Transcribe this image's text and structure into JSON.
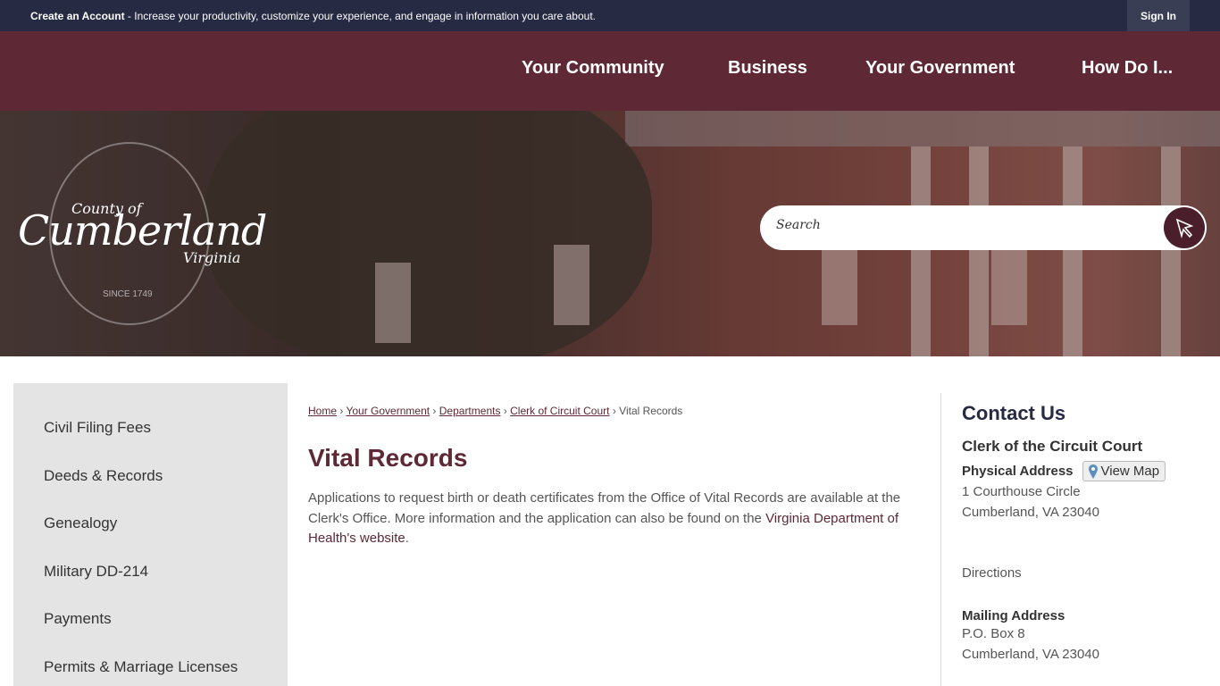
{
  "topbar": {
    "create_account": "Create an Account",
    "message": " - Increase your productivity, customize your experience, and engage in information you care about.",
    "sign_in": "Sign In"
  },
  "nav": [
    "Your Community",
    "Business",
    "Your Government",
    "How Do I..."
  ],
  "logo": {
    "county_of": "County of",
    "name": "Cumberland",
    "state": "Virginia",
    "since": "SINCE 1749"
  },
  "search": {
    "placeholder": "Search"
  },
  "sidebar": [
    "Civil Filing Fees",
    "Deeds & Records",
    "Genealogy",
    "Military DD-214",
    "Payments",
    "Permits & Marriage Licenses"
  ],
  "breadcrumb": {
    "items": [
      "Home",
      "Your Government",
      "Departments",
      "Clerk of Circuit Court"
    ],
    "current": "Vital Records",
    "sep": " › "
  },
  "page": {
    "title": "Vital Records",
    "body": "Applications to request birth or death certificates from the Office of Vital Records are available at the Clerk's Office. More information and the application can also be found on the ",
    "link": "Virginia Department of Health's website",
    "end": "."
  },
  "contact": {
    "title": "Contact Us",
    "dept": "Clerk of the Circuit Court",
    "physical_label": "Physical Address",
    "view_map": "View Map",
    "physical_line1": "1 Courthouse Circle",
    "physical_line2": "Cumberland, VA 23040",
    "directions": "Directions",
    "mailing_label": "Mailing Address",
    "mailing_line1": "P.O. Box 8",
    "mailing_line2": "Cumberland, VA 23040"
  }
}
